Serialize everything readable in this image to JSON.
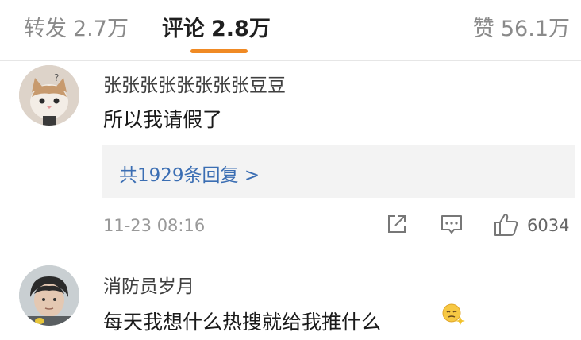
{
  "tabs": {
    "repost": {
      "label": "转发",
      "count": "2.7万"
    },
    "comment": {
      "label": "评论",
      "count": "2.8万"
    },
    "like": {
      "label": "赞",
      "count": "56.1万"
    }
  },
  "accent_color": "#f08a24",
  "comments": [
    {
      "username": "张张张张张张张张豆豆",
      "text": "所以我请假了",
      "replies_link": "共1929条回复 >",
      "time": "11-23 08:16",
      "like_count": "6034",
      "avatar": "cat-avatar"
    },
    {
      "username": "消防员岁月",
      "text": "每天我想什么热搜就给我推什么",
      "emoji": "sleepy-face-emoji",
      "avatar": "person-avatar"
    }
  ]
}
